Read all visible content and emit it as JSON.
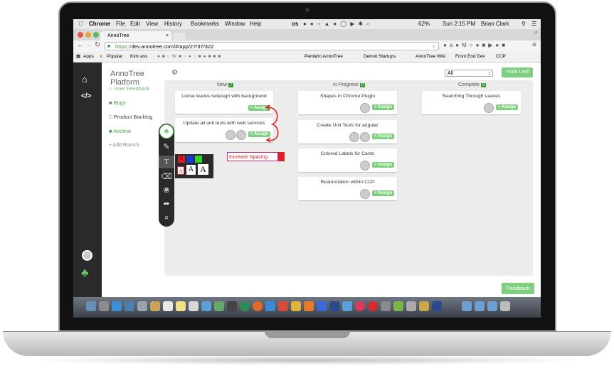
{
  "menubar": {
    "apple": "",
    "items": [
      "Chrome",
      "File",
      "Edit",
      "View",
      "History",
      "Bookmarks",
      "Window",
      "Help"
    ],
    "status": {
      "battery": "62%",
      "clock": "Sun 2:15 PM",
      "user": "Brian Clark",
      "os_label": "os"
    }
  },
  "browser": {
    "tab_title": "AnnoTree",
    "url_scheme": "https://",
    "url_rest": "dev.annotree.com/#/app/27/37/322",
    "bookmarks": [
      "Apps",
      "Popular",
      "Kick ass",
      "Pentaho AnnoTree",
      "Detroit Startups",
      "AnnoTree Wiki",
      "Front End Dev",
      "CCP"
    ]
  },
  "app": {
    "title": "AnnoTree Platform",
    "filter_value": "All",
    "add_leaf_label": "+Add Leaf",
    "nav": [
      {
        "label": "User Feedback",
        "color": "#6bbf6b"
      },
      {
        "label": "Bugs",
        "color": "#4a9f4a"
      },
      {
        "label": "Product Backlog",
        "color": "#444"
      },
      {
        "label": "Archive",
        "color": "#4a9f4a"
      },
      {
        "label": "+ Add Branch",
        "color": "#888"
      }
    ],
    "columns": [
      {
        "name": "New",
        "count": "7",
        "cards": [
          {
            "title": "Loose leaves redesign with background",
            "assign": "+ Assign"
          },
          {
            "title": "Update all unit tests with web services",
            "assign": "+ Assign"
          }
        ]
      },
      {
        "name": "In Progress",
        "count": "0",
        "cards": [
          {
            "title": "Shapes in Chrome Plugin",
            "assign": "+ Assign"
          },
          {
            "title": "Create Unit Tests for angular",
            "assign": "+ Assign"
          },
          {
            "title": "Colored Labels for Cards",
            "assign": "+ Assign"
          },
          {
            "title": "Reannotation within CCP",
            "assign": "+ Assign"
          }
        ]
      },
      {
        "name": "Complete",
        "count": "0",
        "cards": [
          {
            "title": "Searching Through Leaves",
            "assign": "+ Assign"
          }
        ]
      }
    ],
    "annotation_text": "Increase Spacing",
    "color_swatch_x": "X",
    "font_sample": "A",
    "feedback_label": "Feedback"
  },
  "colors": {
    "accent": "#7ed07e",
    "count_badge": "#3a9b3a",
    "annotation": "#e02020"
  }
}
